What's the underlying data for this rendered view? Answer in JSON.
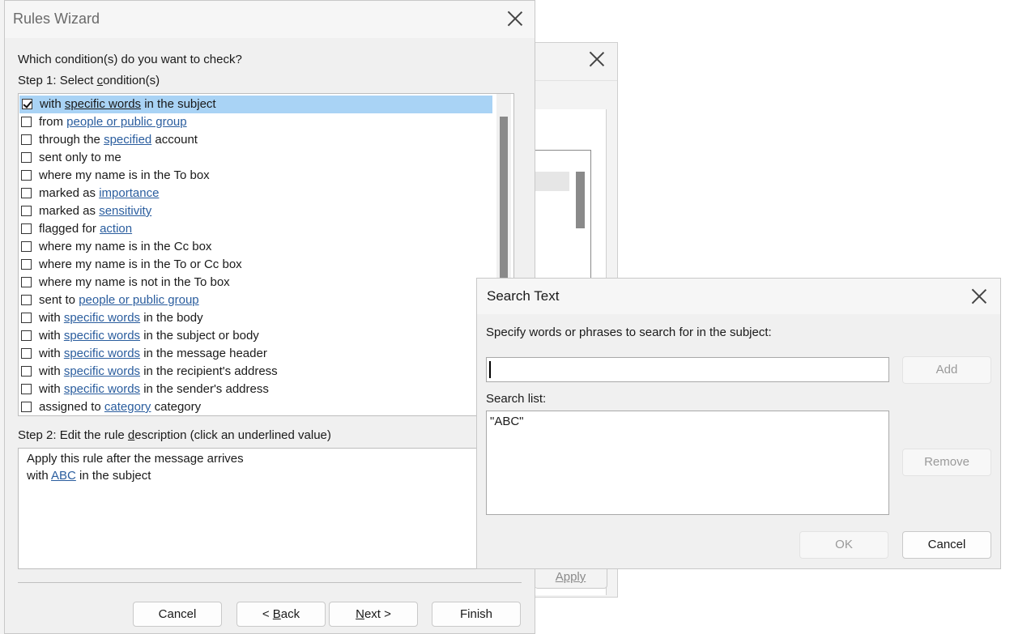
{
  "rules_wizard": {
    "title": "Rules Wizard",
    "question": "Which condition(s) do you want to check?",
    "step1_prefix": "Step 1: Select ",
    "step1_underlined": "c",
    "step1_suffix": "ondition(s)",
    "conditions": [
      {
        "checked": true,
        "selected": true,
        "pre": "with ",
        "link": "specific words",
        "post": " in the subject"
      },
      {
        "checked": false,
        "selected": false,
        "pre": "from ",
        "link": "people or public group",
        "post": ""
      },
      {
        "checked": false,
        "selected": false,
        "pre": "through the ",
        "link": "specified",
        "post": " account"
      },
      {
        "checked": false,
        "selected": false,
        "pre": "sent only to me",
        "link": "",
        "post": ""
      },
      {
        "checked": false,
        "selected": false,
        "pre": "where my name is in the To box",
        "link": "",
        "post": ""
      },
      {
        "checked": false,
        "selected": false,
        "pre": "marked as ",
        "link": "importance",
        "post": ""
      },
      {
        "checked": false,
        "selected": false,
        "pre": "marked as ",
        "link": "sensitivity",
        "post": ""
      },
      {
        "checked": false,
        "selected": false,
        "pre": "flagged for ",
        "link": "action",
        "post": ""
      },
      {
        "checked": false,
        "selected": false,
        "pre": "where my name is in the Cc box",
        "link": "",
        "post": ""
      },
      {
        "checked": false,
        "selected": false,
        "pre": "where my name is in the To or Cc box",
        "link": "",
        "post": ""
      },
      {
        "checked": false,
        "selected": false,
        "pre": "where my name is not in the To box",
        "link": "",
        "post": ""
      },
      {
        "checked": false,
        "selected": false,
        "pre": "sent to ",
        "link": "people or public group",
        "post": ""
      },
      {
        "checked": false,
        "selected": false,
        "pre": "with ",
        "link": "specific words",
        "post": " in the body"
      },
      {
        "checked": false,
        "selected": false,
        "pre": "with ",
        "link": "specific words",
        "post": " in the subject or body"
      },
      {
        "checked": false,
        "selected": false,
        "pre": "with ",
        "link": "specific words",
        "post": " in the message header"
      },
      {
        "checked": false,
        "selected": false,
        "pre": "with ",
        "link": "specific words",
        "post": " in the recipient's address"
      },
      {
        "checked": false,
        "selected": false,
        "pre": "with ",
        "link": "specific words",
        "post": " in the sender's address"
      },
      {
        "checked": false,
        "selected": false,
        "pre": "assigned to ",
        "link": "category",
        "post": " category"
      }
    ],
    "step2_prefix": "Step 2: Edit the rule ",
    "step2_underlined": "d",
    "step2_suffix": "escription (click an underlined value)",
    "desc_line1": "Apply this rule after the message arrives",
    "desc_line2_pre": "with ",
    "desc_line2_link": "ABC",
    "desc_line2_post": " in the subject",
    "buttons": {
      "cancel": "Cancel",
      "back_prefix": "< ",
      "back_underlined": "B",
      "back_suffix": "ack",
      "next_underlined": "N",
      "next_suffix": "ext >",
      "finish": "Finish"
    }
  },
  "background_dialog": {
    "apply_label": "Apply"
  },
  "search_dialog": {
    "title": "Search Text",
    "prompt": "Specify words or phrases to search for in the subject:",
    "input_value": "",
    "add_label": "Add",
    "list_label": "Search list:",
    "list_items": [
      "\"ABC\""
    ],
    "remove_label": "Remove",
    "ok_label": "OK",
    "cancel_label": "Cancel"
  },
  "colors": {
    "selection": "#a9d3f5",
    "link": "#2a5d9e",
    "dialog_bg": "#f0f0f0"
  }
}
